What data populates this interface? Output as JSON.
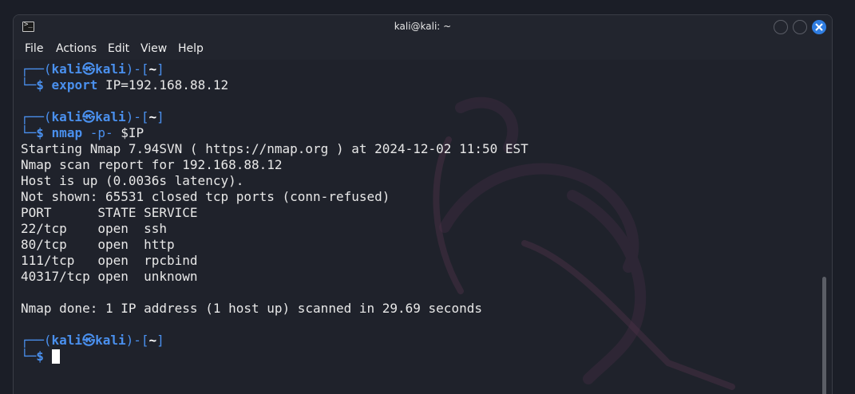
{
  "window": {
    "title": "kali@kali: ~",
    "accent_color": "#2f7de1"
  },
  "menu": {
    "items": [
      "File",
      "Actions",
      "Edit",
      "View",
      "Help"
    ]
  },
  "prompt": {
    "user": "kali",
    "host": "kali",
    "separator": "㉿",
    "cwd": "~",
    "open": "┌──(",
    "mid": ")-[",
    "close": "]",
    "corner": "└─",
    "dollar": "$"
  },
  "commands": {
    "first_cmd": "export",
    "first_args": " IP=192.168.88.12",
    "second_cmd": "nmap",
    "second_opt": " -p- ",
    "second_arg": "$IP"
  },
  "output": [
    "Starting Nmap 7.94SVN ( https://nmap.org ) at 2024-12-02 11:50 EST",
    "Nmap scan report for 192.168.88.12",
    "Host is up (0.0036s latency).",
    "Not shown: 65531 closed tcp ports (conn-refused)",
    "PORT      STATE SERVICE",
    "22/tcp    open  ssh",
    "80/tcp    open  http",
    "111/tcp   open  rpcbind",
    "40317/tcp open  unknown",
    "",
    "Nmap done: 1 IP address (1 host up) scanned in 29.69 seconds"
  ]
}
